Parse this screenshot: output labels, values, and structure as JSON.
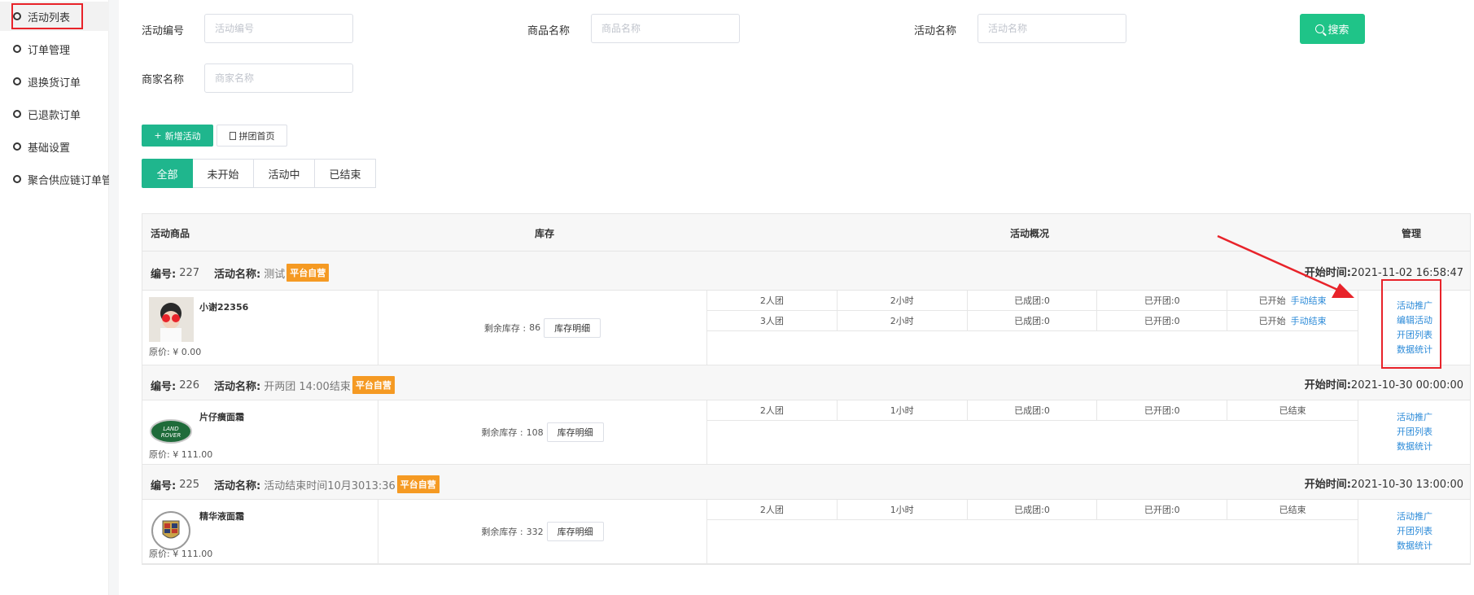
{
  "sidebar": {
    "items": [
      {
        "label": "活动列表"
      },
      {
        "label": "订单管理"
      },
      {
        "label": "退换货订单"
      },
      {
        "label": "已退款订单"
      },
      {
        "label": "基础设置"
      },
      {
        "label": "聚合供应链订单管"
      }
    ]
  },
  "filters": {
    "activity_no": {
      "label": "活动编号",
      "placeholder": "活动编号"
    },
    "product_name": {
      "label": "商品名称",
      "placeholder": "商品名称"
    },
    "activity_name": {
      "label": "活动名称",
      "placeholder": "活动名称"
    },
    "merchant_name": {
      "label": "商家名称",
      "placeholder": "商家名称"
    },
    "search_label": "搜索"
  },
  "toolbar": {
    "add_label": "新增活动",
    "home_label": "拼团首页"
  },
  "tabs": [
    {
      "label": "全部"
    },
    {
      "label": "未开始"
    },
    {
      "label": "活动中"
    },
    {
      "label": "已结束"
    }
  ],
  "table": {
    "headers": {
      "product": "活动商品",
      "stock": "库存",
      "overview": "活动概况",
      "manage": "管理"
    },
    "labels": {
      "no": "编号:",
      "name": "活动名称:",
      "start": "开始时间:",
      "stock_left": "剩余库存 :",
      "stock_detail": "库存明细",
      "price_prefix": "原价: ¥"
    },
    "groups": [
      {
        "id": "227",
        "name": "测试",
        "badge": "平台自营",
        "start_time": "2021-11-02 16:58:47",
        "product": {
          "name": "小谢22356",
          "price": "0.00"
        },
        "stock": "86",
        "rows": [
          {
            "size": "2人团",
            "duration": "2小时",
            "formed": "已成团:0",
            "opened": "已开团:0",
            "status": "已开始",
            "action": "手动结束"
          },
          {
            "size": "3人团",
            "duration": "2小时",
            "formed": "已成团:0",
            "opened": "已开团:0",
            "status": "已开始",
            "action": "手动结束"
          }
        ],
        "manage": [
          "活动推广",
          "编辑活动",
          "开团列表",
          "数据统计"
        ]
      },
      {
        "id": "226",
        "name": "开两团 14:00结束",
        "badge": "平台自营",
        "start_time": "2021-10-30 00:00:00",
        "product": {
          "name": "片仔癀面霜",
          "price": "111.00"
        },
        "stock": "108",
        "rows": [
          {
            "size": "2人团",
            "duration": "1小时",
            "formed": "已成团:0",
            "opened": "已开团:0",
            "status": "已结束",
            "action": ""
          }
        ],
        "manage": [
          "活动推广",
          "开团列表",
          "数据统计"
        ]
      },
      {
        "id": "225",
        "name": "活动结束时间10月3013:36",
        "badge": "平台自营",
        "start_time": "2021-10-30 13:00:00",
        "product": {
          "name": "精华液面霜",
          "price": "111.00"
        },
        "stock": "332",
        "rows": [
          {
            "size": "2人团",
            "duration": "1小时",
            "formed": "已成团:0",
            "opened": "已开团:0",
            "status": "已结束",
            "action": ""
          }
        ],
        "manage": [
          "活动推广",
          "开团列表",
          "数据统计"
        ]
      }
    ]
  },
  "colors": {
    "accent": "#1fb68d",
    "badge": "#f59a23",
    "link": "#2b8ad8",
    "highlight": "#e8232a"
  }
}
